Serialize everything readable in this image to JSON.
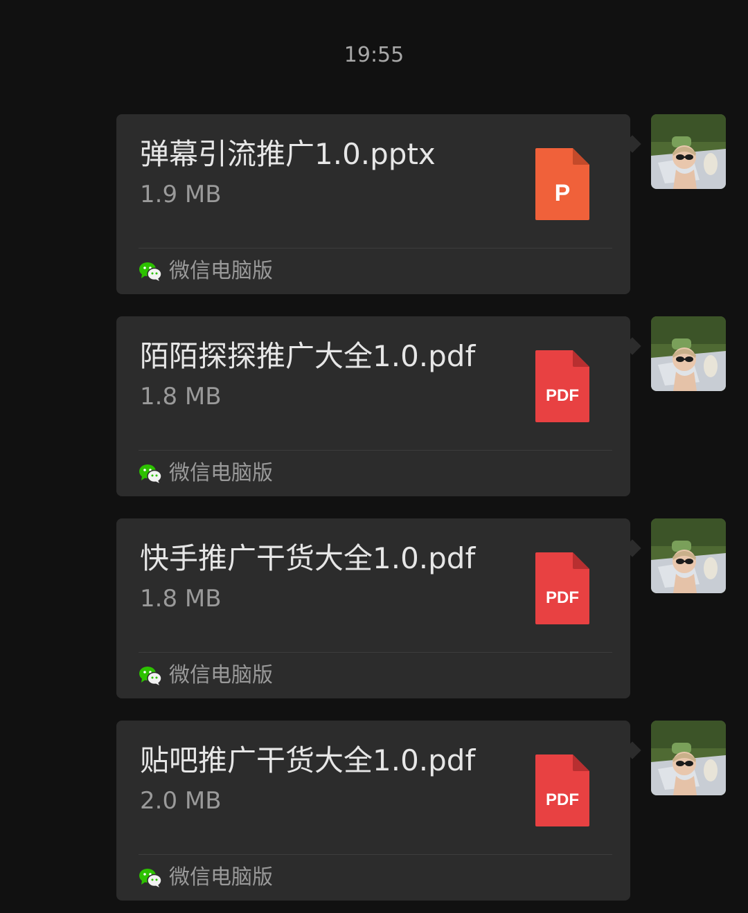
{
  "timestamp": "19:55",
  "messages": [
    {
      "file_name": "弹幕引流推广1.0.pptx",
      "file_size": "1.9 MB",
      "file_type": "pptx",
      "icon_label": "P",
      "icon_color": "#f0613a",
      "icon_fold_color": "#c44a2a",
      "source": "微信电脑版"
    },
    {
      "file_name": "陌陌探探推广大全1.0.pdf",
      "file_size": "1.8 MB",
      "file_type": "pdf",
      "icon_label": "PDF",
      "icon_color": "#e84142",
      "icon_fold_color": "#b82f30",
      "source": "微信电脑版"
    },
    {
      "file_name": "快手推广干货大全1.0.pdf",
      "file_size": "1.8 MB",
      "file_type": "pdf",
      "icon_label": "PDF",
      "icon_color": "#e84142",
      "icon_fold_color": "#b82f30",
      "source": "微信电脑版"
    },
    {
      "file_name": "贴吧推广干货大全1.0.pdf",
      "file_size": "2.0 MB",
      "file_type": "pdf",
      "icon_label": "PDF",
      "icon_color": "#e84142",
      "icon_fold_color": "#b82f30",
      "source": "微信电脑版"
    }
  ],
  "colors": {
    "background": "#111111",
    "bubble": "#2c2c2c",
    "wechat_green": "#2dc100"
  }
}
